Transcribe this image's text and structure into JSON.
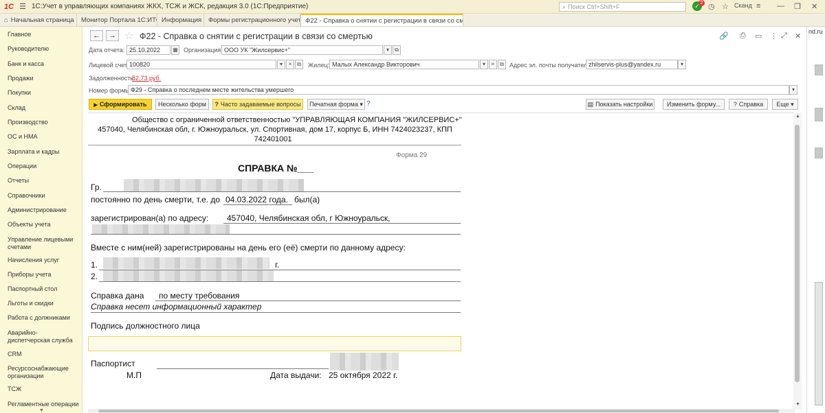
{
  "titlebar": {
    "logo": "1С",
    "title": "1С:Учет в управляющих компаниях ЖКХ, ТСЖ и ЖСК, редакция 3.0  (1С:Предприятие)",
    "search_placeholder": "Поиск Ctrl+Shift+F",
    "notifications": "2",
    "user": "Сканд"
  },
  "tabs": [
    {
      "label": "Начальная страница"
    },
    {
      "label": "Монитор Портала 1С:ИТС"
    },
    {
      "label": "Информация"
    },
    {
      "label": "Формы регистрационного учета"
    },
    {
      "label": "Ф22 - Справка о снятии с регистрации в связи со смертью"
    }
  ],
  "sidebar": {
    "items": [
      "Главное",
      "Руководителю",
      "Банк и касса",
      "Продажи",
      "Покупки",
      "Склад",
      "Производство",
      "ОС и НМА",
      "Зарплата и кадры",
      "Операции",
      "Отчеты",
      "Справочники",
      "Администрирование",
      "Объекты учета",
      "Управление лицевыми счетами",
      "Начисления услуг",
      "Приборы учета",
      "Паспортный стол",
      "Льготы и скидки",
      "Работа с должниками",
      "Аварийно-диспетчерская служба",
      "CRM",
      "Ресурсоснабжающие организации",
      "ТСЖ",
      "Регламентные операции"
    ]
  },
  "right_strip": {
    "text": "nd.ru"
  },
  "document": {
    "title": "Ф22 - Справка о снятии с регистрации в связи со смертью",
    "report_date_label": "Дата отчета:",
    "report_date": "25.10.2022",
    "org_label": "Организация:",
    "org_value": "ООО УК \"Жилсервис+\"",
    "account_label": "Лицевой счет:",
    "account_value": "100820",
    "tenant_label": "Жилец:",
    "tenant_value": "Малых Александр Викторович",
    "email_label": "Адрес эл. почты получателя:",
    "email_value": "zhilservis-plus@yandex.ru",
    "debt_label": "Задолженность:",
    "debt_value": "52,73 руб.",
    "form_number_label": "Номер формы:",
    "form_number_value": "Ф29 - Справка о последнем месте жительства умершего"
  },
  "toolbar": {
    "generate": "Сформировать",
    "several_forms": "Несколько форм",
    "faq": "Часто задаваемые вопросы",
    "print_form": "Печатная форма",
    "help_mark": "?",
    "show_settings": "Показать настройки",
    "change_form": "Изменить форму...",
    "help": "Справка",
    "more": "Еще"
  },
  "report": {
    "org_line1": "Общество с ограниченной ответственностью \"УПРАВЛЯЮЩАЯ КОМПАНИЯ \"ЖИЛСЕРВИС+\"",
    "org_line2": "457040, Челябинская обл, г. Южноуральск, ул. Спортивная, дом 17, корпус Б, ИНН 7424023237, КПП",
    "org_line3": "742401001",
    "form_label": "Форма 29",
    "heading": "СПРАВКА №___",
    "citizen_prefix": "Гр.",
    "death_line_prefix": "постоянно по день смерти, т.е. до",
    "death_date": "04.03.2022 года.",
    "death_line_suffix": "был(а)",
    "registered_label": "зарегистрирован(а) по адресу:",
    "registered_address": "457040, Челябинская обл, г Южноуральск,",
    "together_line": "Вместе с ним(ней) зарегистрированы на день его (её) смерти по данному адресу:",
    "person1_num": "1.",
    "person1_suffix": "г.",
    "person2_num": "2.",
    "issued_label": "Справка дана",
    "issued_value": "по месту требования",
    "info_note": "Справка несет информационный характер",
    "signature_label": "Подпись должностного лица",
    "passport_officer": "Паспортист",
    "stamp": "М.П",
    "issue_date_label": "Дата выдачи:",
    "issue_date": "25 октября 2022 г."
  }
}
